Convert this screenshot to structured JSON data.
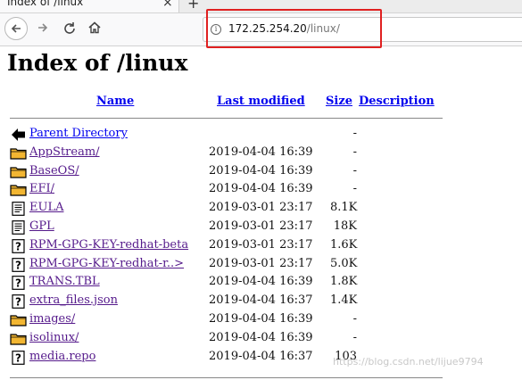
{
  "browser": {
    "tab_title": "Index of /linux",
    "tab_close_glyph": "×",
    "new_tab_glyph": "+",
    "url_host": "172.25.254.20",
    "url_path": "/linux/",
    "icons": [
      "back-arrow-icon",
      "forward-arrow-icon",
      "reload-icon",
      "home-icon",
      "info-icon"
    ],
    "highlight_color": "#e02020"
  },
  "page": {
    "title": "Index of /linux",
    "columns": {
      "name": "Name",
      "last_modified": "Last modified",
      "size": "Size",
      "description": "Description"
    },
    "entries": [
      {
        "name": "Parent Directory",
        "date": "",
        "size": "-",
        "icon": "parent-directory-icon"
      },
      {
        "name": "AppStream/",
        "date": "2019-04-04 16:39",
        "size": "-",
        "icon": "folder-icon"
      },
      {
        "name": "BaseOS/",
        "date": "2019-04-04 16:39",
        "size": "-",
        "icon": "folder-icon"
      },
      {
        "name": "EFI/",
        "date": "2019-04-04 16:39",
        "size": "-",
        "icon": "folder-icon"
      },
      {
        "name": "EULA",
        "date": "2019-03-01 23:17",
        "size": "8.1K",
        "icon": "text-file-icon"
      },
      {
        "name": "GPL",
        "date": "2019-03-01 23:17",
        "size": "18K",
        "icon": "text-file-icon"
      },
      {
        "name": "RPM-GPG-KEY-redhat-beta",
        "date": "2019-03-01 23:17",
        "size": "1.6K",
        "icon": "unknown-file-icon"
      },
      {
        "name": "RPM-GPG-KEY-redhat-r..>",
        "date": "2019-03-01 23:17",
        "size": "5.0K",
        "icon": "unknown-file-icon"
      },
      {
        "name": "TRANS.TBL",
        "date": "2019-04-04 16:39",
        "size": "1.8K",
        "icon": "unknown-file-icon"
      },
      {
        "name": "extra_files.json",
        "date": "2019-04-04 16:37",
        "size": "1.4K",
        "icon": "unknown-file-icon"
      },
      {
        "name": "images/",
        "date": "2019-04-04 16:39",
        "size": "-",
        "icon": "folder-icon"
      },
      {
        "name": "isolinux/",
        "date": "2019-04-04 16:39",
        "size": "-",
        "icon": "folder-icon"
      },
      {
        "name": "media.repo",
        "date": "2019-04-04 16:37",
        "size": "103",
        "icon": "unknown-file-icon"
      }
    ]
  },
  "watermark": "https://blog.csdn.net/lijue9794",
  "colors": {
    "link_visited": "#551a8b",
    "link_unvisited": "#0000ee",
    "folder_fill": "#f2b632"
  }
}
